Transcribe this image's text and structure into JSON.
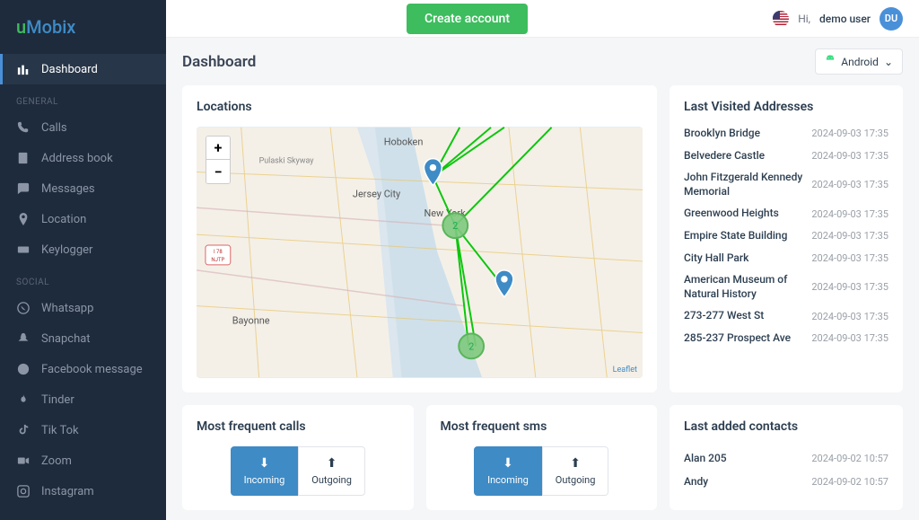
{
  "logo": {
    "u": "u",
    "m": "Mobix"
  },
  "nav": {
    "dashboard": "Dashboard",
    "sections": {
      "general": "GENERAL",
      "social": "SOCIAL"
    },
    "general": {
      "calls": "Calls",
      "addressbook": "Address book",
      "messages": "Messages",
      "location": "Location",
      "keylogger": "Keylogger"
    },
    "social": {
      "whatsapp": "Whatsapp",
      "snapchat": "Snapchat",
      "fbmessage": "Facebook message",
      "tinder": "Tinder",
      "tiktok": "Tik Tok",
      "zoom": "Zoom",
      "instagram": "Instagram"
    }
  },
  "topbar": {
    "create": "Create account",
    "hi": "Hi,",
    "user": "demo user",
    "initials": "DU"
  },
  "page": {
    "title": "Dashboard",
    "platform": "Android"
  },
  "locations": {
    "title": "Locations",
    "zoom_in": "+",
    "zoom_out": "−",
    "attrib": "Leaflet"
  },
  "addresses": {
    "title": "Last Visited Addresses",
    "items": [
      {
        "name": "Brooklyn Bridge",
        "date": "2024-09-03 17:35"
      },
      {
        "name": "Belvedere Castle",
        "date": "2024-09-03 17:35"
      },
      {
        "name": "John Fitzgerald Kennedy Memorial",
        "date": "2024-09-03 17:35"
      },
      {
        "name": "Greenwood Heights",
        "date": "2024-09-03 17:35"
      },
      {
        "name": "Empire State Building",
        "date": "2024-09-03 17:35"
      },
      {
        "name": "City Hall Park",
        "date": "2024-09-03 17:35"
      },
      {
        "name": "American Museum of Natural History",
        "date": "2024-09-03 17:35"
      },
      {
        "name": "273-277 West St",
        "date": "2024-09-03 17:35"
      },
      {
        "name": "285-237 Prospect Ave",
        "date": "2024-09-03 17:35"
      }
    ]
  },
  "calls": {
    "title": "Most frequent calls",
    "incoming": "Incoming",
    "outgoing": "Outgoing"
  },
  "sms": {
    "title": "Most frequent sms",
    "incoming": "Incoming",
    "outgoing": "Outgoing"
  },
  "contacts": {
    "title": "Last added contacts",
    "items": [
      {
        "name": "Alan 205",
        "date": "2024-09-02 10:57"
      },
      {
        "name": "Andy",
        "date": "2024-09-02 10:57"
      }
    ]
  },
  "map_labels": {
    "hoboken": "Hoboken",
    "pulaski": "Pulaski Skyway",
    "newyork": "New York",
    "jersey": "Jersey City",
    "bayonne": "Bayonne",
    "i78": "I 78",
    "njtp": "NJTP"
  }
}
